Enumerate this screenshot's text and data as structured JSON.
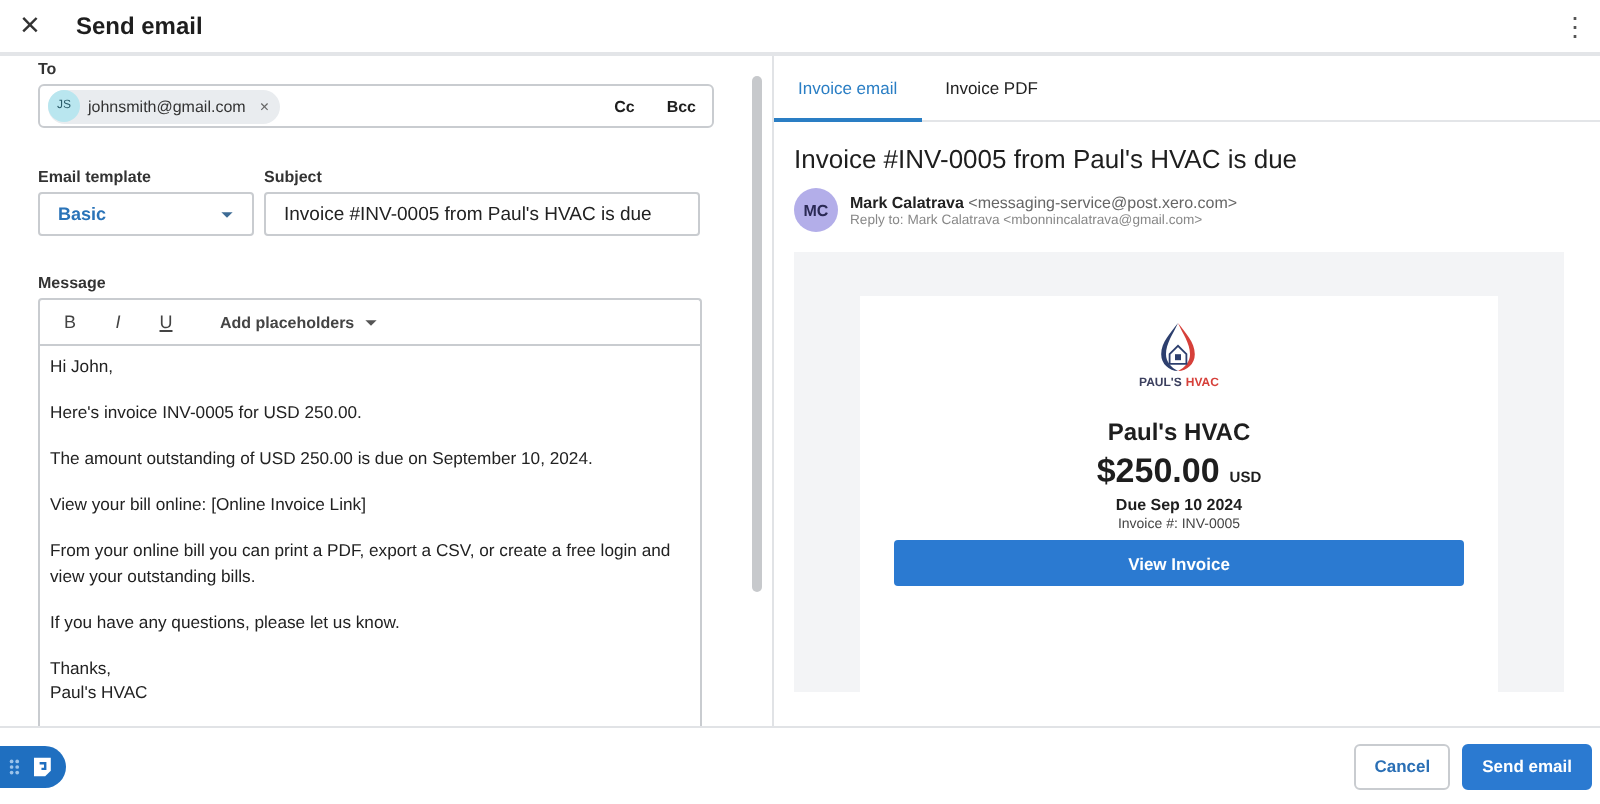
{
  "header": {
    "close": "×",
    "title": "Send email",
    "more": "⋮"
  },
  "to": {
    "label": "To",
    "recipients": [
      {
        "initials": "JS",
        "email": "johnsmith@gmail.com",
        "remove": "×"
      }
    ],
    "cc": "Cc",
    "bcc": "Bcc"
  },
  "template": {
    "label": "Email template",
    "value": "Basic"
  },
  "subject": {
    "label": "Subject",
    "value": "Invoice #INV-0005 from Paul's HVAC is due"
  },
  "message": {
    "label": "Message",
    "format_buttons": [
      {
        "kind": "bold",
        "label": "B"
      },
      {
        "kind": "italic",
        "label": "I"
      },
      {
        "kind": "underline",
        "label": "U"
      }
    ],
    "placeholders": "Add placeholders",
    "paragraphs": [
      [
        "Hi John,"
      ],
      [
        "Here's invoice INV-0005 for USD 250.00."
      ],
      [
        "The amount outstanding of USD 250.00 is due on September 10, 2024."
      ],
      [
        "View your bill online: [Online Invoice Link]"
      ],
      [
        "From your online bill you can print a PDF, export a CSV, or create a free login and view your outstanding bills."
      ],
      [
        "If you have any questions, please let us know."
      ],
      [
        "Thanks,",
        "Paul's HVAC"
      ]
    ]
  },
  "preview": {
    "tabs": [
      {
        "label": "Invoice email",
        "selected": true
      },
      {
        "label": "Invoice PDF",
        "selected": false
      }
    ],
    "subject": "Invoice #INV-0005 from Paul's HVAC is due",
    "sender": {
      "initials": "MC",
      "name": "Mark Calatrava",
      "address": "<messaging-service@post.xero.com>",
      "reply_to": "Reply to: Mark Calatrava <mbonnincalatrava@gmail.com>"
    },
    "card": {
      "logo_words": [
        {
          "text": "PAUL'S",
          "color": "#3b3f5e"
        },
        {
          "text": "HVAC",
          "color": "#d6403a"
        }
      ],
      "company": "Paul's HVAC",
      "amount": "$250.00",
      "currency": "USD",
      "due": "Due Sep 10 2024",
      "invoice_number": "Invoice #: INV-0005",
      "button": "View Invoice"
    }
  },
  "footer": {
    "buttons": [
      {
        "kind": "secondary",
        "label": "Cancel"
      },
      {
        "kind": "primary",
        "label": "Send email"
      }
    ]
  }
}
